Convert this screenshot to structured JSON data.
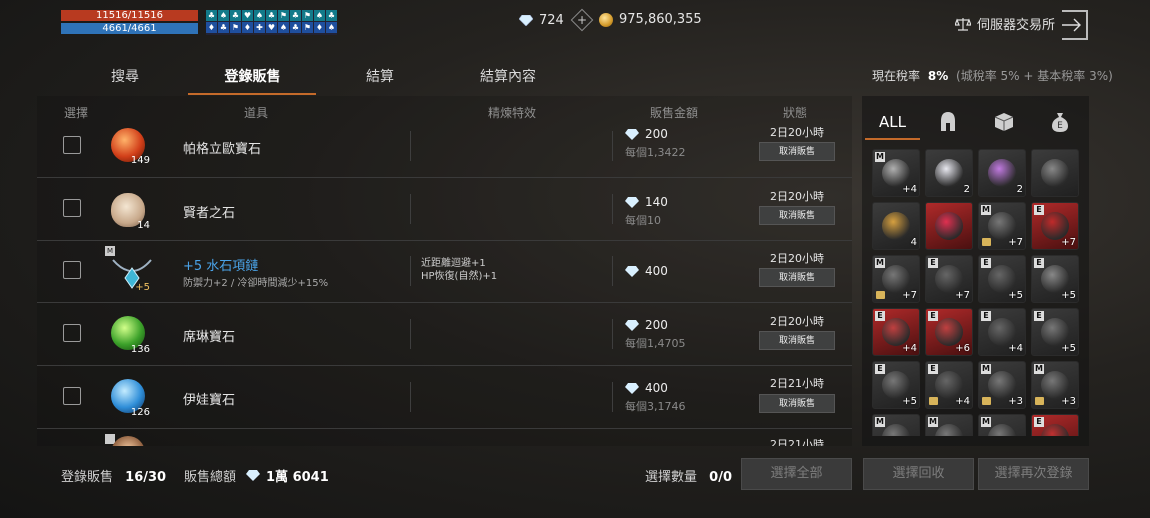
{
  "player": {
    "hp": "11516/11516",
    "mp": "4661/4661"
  },
  "buffs": [
    "♣",
    "♠",
    "♣",
    "♥",
    "♠",
    "♣",
    "⚑",
    "♣",
    "⚑",
    "♠",
    "♣",
    "♦",
    "♣",
    "⚑",
    "♦",
    "✚",
    "♥",
    "♠",
    "♣",
    "⚑",
    "♦",
    "♠"
  ],
  "currency": {
    "diamonds": "724",
    "gold": "975,860,355"
  },
  "server_exchange": {
    "label": "伺服器交易所"
  },
  "tabs": [
    {
      "label": "搜尋"
    },
    {
      "label": "登錄販售",
      "active": true
    },
    {
      "label": "結算"
    },
    {
      "label": "結算內容"
    }
  ],
  "tax": {
    "label": "現在稅率",
    "value": "8%",
    "detail": "(城稅率 5% + 基本稅率 3%)"
  },
  "table": {
    "headers": [
      "選擇",
      "道具",
      "精煉特效",
      "販售金額",
      "狀態"
    ],
    "rows": [
      {
        "name": "帕格立歐寶石",
        "qty": "149",
        "price": "200",
        "each": "每個1,3422",
        "time": "2日20小時",
        "action": "取消販售"
      },
      {
        "name": "賢者之石",
        "qty": "14",
        "price": "140",
        "each": "每個10",
        "time": "2日20小時",
        "action": "取消販售"
      },
      {
        "name": "+5 水石項鏈",
        "sub": "防禦力+2 / 冷卻時間減少+15%",
        "qty": "+5",
        "effect1": "近距離迴避+1",
        "effect2": "HP恢復(自然)+1",
        "price": "400",
        "time": "2日20小時",
        "action": "取消販售"
      },
      {
        "name": "席琳寶石",
        "qty": "136",
        "price": "200",
        "each": "每個1,4705",
        "time": "2日20小時",
        "action": "取消販售"
      },
      {
        "name": "伊娃寶石",
        "qty": "126",
        "price": "400",
        "each": "每個3,1746",
        "time": "2日21小時",
        "action": "取消販售"
      },
      {
        "time": "2日21小時"
      }
    ]
  },
  "footer": {
    "registered_label": "登錄販售",
    "registered_value": "16/30",
    "total_label": "販售總額",
    "total_value": "1萬 6041",
    "select_label": "選擇數量",
    "select_value": "0/0",
    "btn_select_all": "選擇全部",
    "btn_recall": "選擇回收",
    "btn_reregister": "選擇再次登錄"
  },
  "inventory": {
    "filters": [
      "ALL",
      "helmet-icon",
      "box-icon",
      "moneybag-icon"
    ],
    "slots": [
      {
        "n": "+4",
        "badge": "M"
      },
      {
        "n": "2"
      },
      {
        "n": "2"
      },
      {
        "n": ""
      },
      {
        "n": "4",
        "red": false
      },
      {
        "n": "",
        "red": true
      },
      {
        "n": "+7",
        "badge": "M",
        "lock": true
      },
      {
        "n": "+7",
        "badge": "E",
        "red": true
      },
      {
        "n": "+7",
        "badge": "M",
        "lock": true
      },
      {
        "n": "+7",
        "badge": "E"
      },
      {
        "n": "+5",
        "badge": "E"
      },
      {
        "n": "+5",
        "badge": "E"
      },
      {
        "n": "+4",
        "badge": "E",
        "red": true
      },
      {
        "n": "+6",
        "badge": "E",
        "red": true
      },
      {
        "n": "+4",
        "badge": "E"
      },
      {
        "n": "+5",
        "badge": "E"
      },
      {
        "n": "+5",
        "badge": "E"
      },
      {
        "n": "+4",
        "badge": "E",
        "lock": true
      },
      {
        "n": "+3",
        "badge": "M",
        "lock": true
      },
      {
        "n": "+3",
        "badge": "M",
        "lock": true
      },
      {
        "n": "",
        "badge": "M"
      },
      {
        "n": "",
        "badge": "M"
      },
      {
        "n": "",
        "badge": "M"
      },
      {
        "n": "",
        "badge": "E",
        "red": true
      }
    ]
  },
  "colors": {
    "accent": "#c46a2a",
    "hp": "#b83a20",
    "mp": "#2f73b8",
    "enhanced_name": "#4aa3e8"
  }
}
